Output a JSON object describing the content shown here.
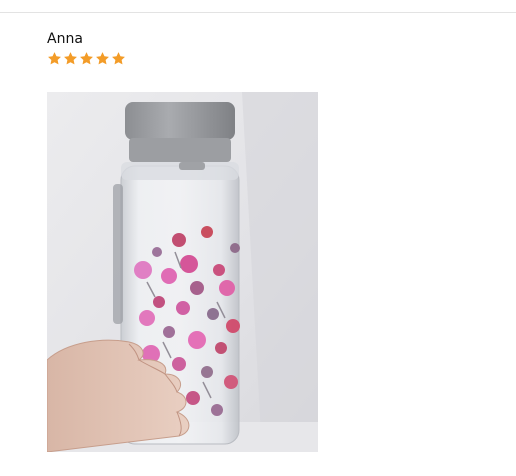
{
  "review": {
    "reviewer_name": "Anna",
    "rating": 5,
    "rating_max": 5,
    "star_color": "#f39c28"
  },
  "photo": {
    "description_icon": "photo-thumbnail"
  }
}
